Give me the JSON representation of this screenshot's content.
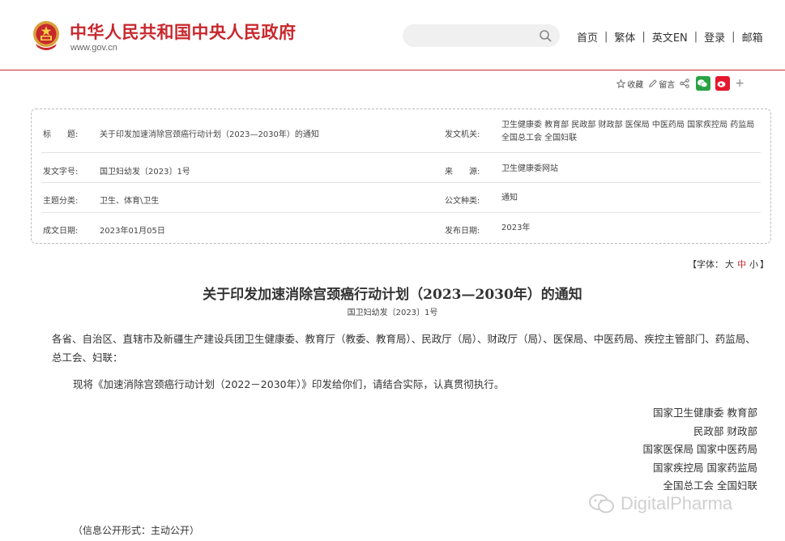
{
  "header": {
    "site_title": "中华人民共和国中央人民政府",
    "site_url": "www.gov.cn",
    "search_placeholder": "",
    "nav": [
      "首页",
      "繁体",
      "英文EN",
      "登录",
      "邮箱"
    ],
    "brand_color": "#c8282d"
  },
  "share": {
    "favorite": "收藏",
    "comment": "留言",
    "icons": [
      "star-icon",
      "comment-icon",
      "share-icon",
      "wechat-icon",
      "weibo-icon",
      "plus-icon"
    ]
  },
  "meta": {
    "title_label": "标　　题:",
    "title_value": "关于印发加速消除宫颈癌行动计划（2023—2030年）的通知",
    "issuer_label": "发文机关:",
    "issuer_value": "卫生健康委  教育部  民政部  财政部  医保局  中医药局  国家疾控局  药监局  全国总工会  全国妇联",
    "docno_label": "发文字号:",
    "docno_value": "国卫妇幼发〔2023〕1号",
    "source_label": "来　　源:",
    "source_value": "卫生健康委网站",
    "topic_label": "主题分类:",
    "topic_value": "卫生、体育\\卫生",
    "type_label": "公文种类:",
    "type_value": "通知",
    "date_label": "成文日期:",
    "date_value": "2023年01月05日",
    "pubdate_label": "发布日期:",
    "pubdate_value": "2023年"
  },
  "font_size": {
    "prefix": "【字体：",
    "large": "大",
    "medium": "中",
    "small": "小",
    "suffix": "】"
  },
  "document": {
    "title": "关于印发加速消除宫颈癌行动计划（2023—2030年）的通知",
    "number": "国卫妇幼发〔2023〕1号",
    "addressee": "各省、自治区、直辖市及新疆生产建设兵团卫生健康委、教育厅（教委、教育局）、民政厅（局）、财政厅（局）、医保局、中医药局、疾控主管部门、药监局、总工会、妇联：",
    "body": "现将《加速消除宫颈癌行动计划（2022－2030年）》印发给你们，请结合实际，认真贯彻执行。",
    "signatures": [
      "国家卫生健康委  教育部",
      "民政部  财政部",
      "国家医保局  国家中医药局",
      "国家疾控局  国家药监局",
      "全国总工会  全国妇联"
    ],
    "info_open": "（信息公开形式：主动公开）"
  },
  "watermark": "DigitalPharma"
}
